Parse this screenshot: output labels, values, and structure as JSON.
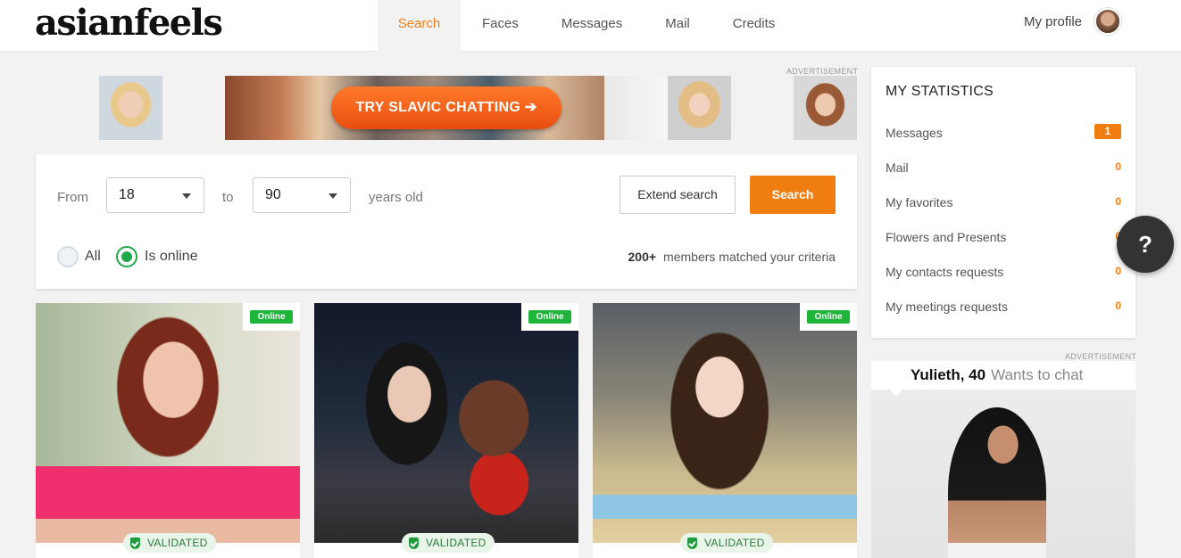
{
  "header": {
    "logo": "asianfeels",
    "nav": [
      "Search",
      "Faces",
      "Messages",
      "Mail",
      "Credits"
    ],
    "active_nav": "Search",
    "profile_label": "My profile"
  },
  "ad_strip": {
    "label": "ADVERTISEMENT",
    "cta": "TRY SLAVIC CHATTING ➔"
  },
  "search": {
    "from_label": "From",
    "from_value": "18",
    "to_label": "to",
    "to_value": "90",
    "suffix": "years old",
    "extend_button": "Extend search",
    "search_button": "Search",
    "radio_all": "All",
    "radio_online": "Is online",
    "selected_radio": "Is online",
    "match_count": "200+",
    "match_text": "members matched your criteria"
  },
  "cards": [
    {
      "badge": "Online",
      "validated": "VALIDATED"
    },
    {
      "badge": "Online",
      "validated": "VALIDATED"
    },
    {
      "badge": "Online",
      "validated": "VALIDATED"
    }
  ],
  "stats": {
    "title": "MY STATISTICS",
    "rows": [
      {
        "label": "Messages",
        "count": "1"
      },
      {
        "label": "Mail",
        "count": "0"
      },
      {
        "label": "My favorites",
        "count": "0"
      },
      {
        "label": "Flowers and Presents",
        "count": "0"
      },
      {
        "label": "My contacts requests",
        "count": "0"
      },
      {
        "label": "My meetings requests",
        "count": "0"
      }
    ]
  },
  "help_button": "?",
  "side_ad": {
    "label": "ADVERTISEMENT",
    "name": "Yulieth, 40",
    "subtitle": "Wants to chat"
  },
  "colors": {
    "accent": "#f07d0f",
    "online": "#1fb43a",
    "validated_text": "#2a7a3a"
  }
}
